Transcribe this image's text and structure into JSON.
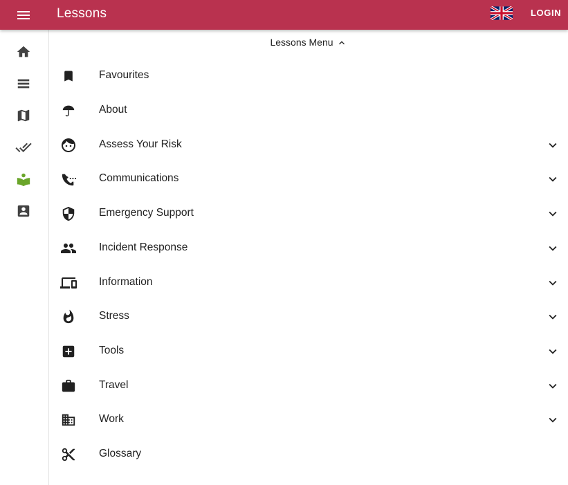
{
  "app": {
    "title": "Lessons",
    "login_label": "LOGIN",
    "brand_color": "#b9324f",
    "menu_icon": "hamburger-menu-icon",
    "language_icon": "uk-flag-icon"
  },
  "rail": {
    "items": [
      {
        "icon": "home-icon",
        "active": false
      },
      {
        "icon": "view-list-icon",
        "active": false
      },
      {
        "icon": "map-icon",
        "active": false
      },
      {
        "icon": "double-check-icon",
        "active": false
      },
      {
        "icon": "lesson-book-icon",
        "active": true,
        "color": "#6aa52a"
      },
      {
        "icon": "contact-card-icon",
        "active": false
      }
    ]
  },
  "lessons_menu": {
    "header_label": "Lessons Menu",
    "header_icon": "chevron-up-icon",
    "items": [
      {
        "label": "Favourites",
        "icon": "bookmark-icon",
        "expandable": false
      },
      {
        "label": "About",
        "icon": "umbrella-icon",
        "expandable": false
      },
      {
        "label": "Assess Your Risk",
        "icon": "face-icon",
        "expandable": true
      },
      {
        "label": "Communications",
        "icon": "phone-dialing-icon",
        "expandable": true
      },
      {
        "label": "Emergency Support",
        "icon": "shield-icon",
        "expandable": true
      },
      {
        "label": "Incident Response",
        "icon": "people-icon",
        "expandable": true
      },
      {
        "label": "Information",
        "icon": "devices-icon",
        "expandable": true
      },
      {
        "label": "Stress",
        "icon": "flame-icon",
        "expandable": true
      },
      {
        "label": "Tools",
        "icon": "medical-cross-icon",
        "expandable": true
      },
      {
        "label": "Travel",
        "icon": "briefcase-icon",
        "expandable": true
      },
      {
        "label": "Work",
        "icon": "office-building-icon",
        "expandable": true
      },
      {
        "label": "Glossary",
        "icon": "scissors-icon",
        "expandable": false
      }
    ]
  }
}
